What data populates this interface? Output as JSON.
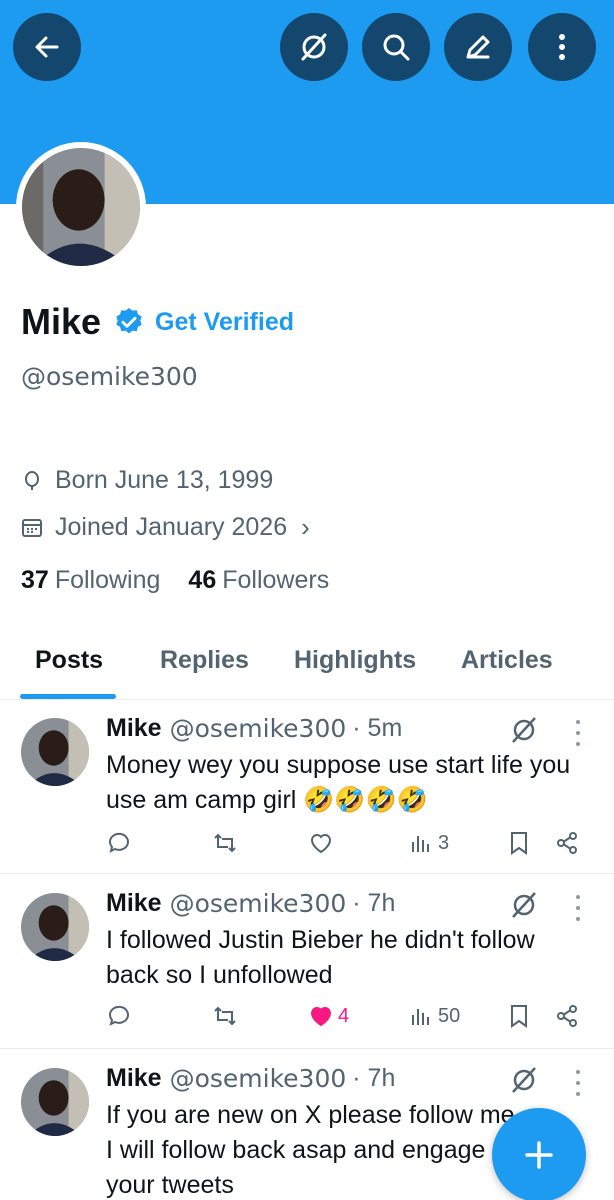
{
  "header": {
    "back_icon": "arrow-left-icon",
    "grok_icon": "grok-icon",
    "search_icon": "search-icon",
    "edit_icon": "pencil-icon",
    "more_icon": "more-vertical-icon",
    "banner_color": "#1d9bf0"
  },
  "profile": {
    "display_name": "Mike",
    "get_verified": "Get Verified",
    "handle": "@osemike300",
    "born": "Born June 13, 1999",
    "joined": "Joined January 2026",
    "following_count": "37",
    "following_label": "Following",
    "followers_count": "46",
    "followers_label": "Followers"
  },
  "tabs": [
    {
      "label": "Posts",
      "active": true
    },
    {
      "label": "Replies",
      "active": false
    },
    {
      "label": "Highlights",
      "active": false
    },
    {
      "label": "Articles",
      "active": false
    }
  ],
  "posts": [
    {
      "name": "Mike",
      "handle": "@osemike300",
      "time": "· 5m",
      "text": "Money wey you suppose use start life you use am camp girl 🤣🤣🤣🤣",
      "likes": "",
      "views": "3"
    },
    {
      "name": "Mike",
      "handle": "@osemike300",
      "time": "· 7h",
      "text": "I followed Justin Bieber he didn't follow back so I unfollowed",
      "likes": "4",
      "views": "50"
    },
    {
      "name": "Mike",
      "handle": "@osemike300",
      "time": "· 7h",
      "text": "If you are new on X please follow me I will follow back asap and engage your tweets",
      "likes": "",
      "views": ""
    }
  ],
  "colors": {
    "accent": "#1d9bf0",
    "like": "#f91880",
    "secondary_text": "#536471"
  }
}
